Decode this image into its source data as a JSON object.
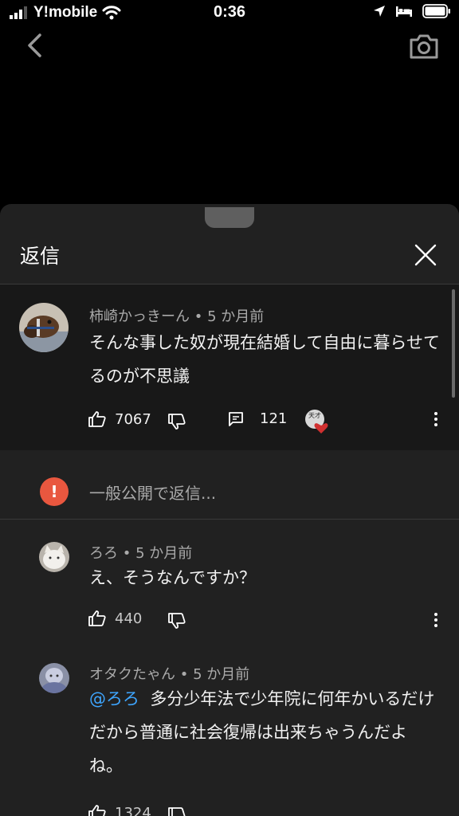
{
  "status": {
    "carrier": "Y!mobile",
    "time": "0:36"
  },
  "sheet": {
    "title": "返信"
  },
  "main_comment": {
    "author": "柿崎かっきーん",
    "age": "5 か月前",
    "text": "そんな事した奴が現在結婚して自由に暮らせてるのが不思議",
    "likes": "7067",
    "replies": "121"
  },
  "reply_input": {
    "badge": "!",
    "placeholder": "一般公開で返信..."
  },
  "replies": [
    {
      "author": "ろろ",
      "age": "5 か月前",
      "text": "え、そうなんですか？",
      "likes": "440"
    },
    {
      "author": "オタクたゃん",
      "age": "5 か月前",
      "mention": "@ろろ",
      "text": "多分少年法で少年院に何年かいるだけだから普通に社会復帰は出来ちゃうんだよね。",
      "likes": "1324"
    }
  ],
  "separator": "•",
  "creator_heart_badge": "天才",
  "colors": {
    "sheet_bg": "#212121",
    "highlight_bg": "#181818",
    "mention": "#3ea6ff",
    "badge": "#e9573f"
  }
}
